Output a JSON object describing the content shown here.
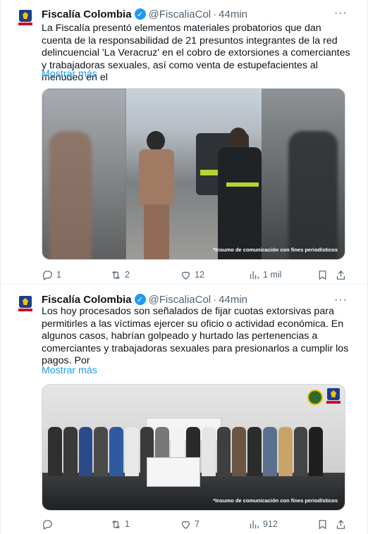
{
  "colors": {
    "text": "#0f1419",
    "secondary": "#536471",
    "link": "#1d9bf0",
    "verified": "#1d9bf0",
    "border": "#eff3f4"
  },
  "tweets": [
    {
      "name": "Fiscalía Colombia",
      "verified_icon": "verified-badge-icon",
      "handle": "@FiscaliaCol",
      "separator": "·",
      "time": "44min",
      "more_icon": "···",
      "text": "La Fiscalía presentó elementos materiales probatorios que dan cuenta de la responsabilidad de 21 presuntos integrantes de la red delincuencial 'La Veracruz' en el cobro de extorsiones a comerciantes y trabajadoras sexuales, así como venta de estupefacientes al menudeo en el",
      "show_more": "Mostrar más",
      "media_caption": "*Insumo de comunicación con fines periodísticos",
      "replies": "1",
      "retweets": "2",
      "likes": "12",
      "views": "1 mil"
    },
    {
      "name": "Fiscalía Colombia",
      "verified_icon": "verified-badge-icon",
      "handle": "@FiscaliaCol",
      "separator": "·",
      "time": "44min",
      "more_icon": "···",
      "text": "Los hoy procesados son señalados de fijar cuotas extorsivas para permitirles a las víctimas ejercer su oficio o actividad económica. En algunos casos, habrían golpeado y hurtado las pertenencias a comerciantes y trabajadoras sexuales para presionarlos a cumplir los pagos. Por",
      "show_more": "Mostrar más",
      "media_caption": "*Insumo de comunicación con fines periodísticos",
      "replies": "",
      "retweets": "1",
      "likes": "7",
      "views": "912"
    }
  ]
}
